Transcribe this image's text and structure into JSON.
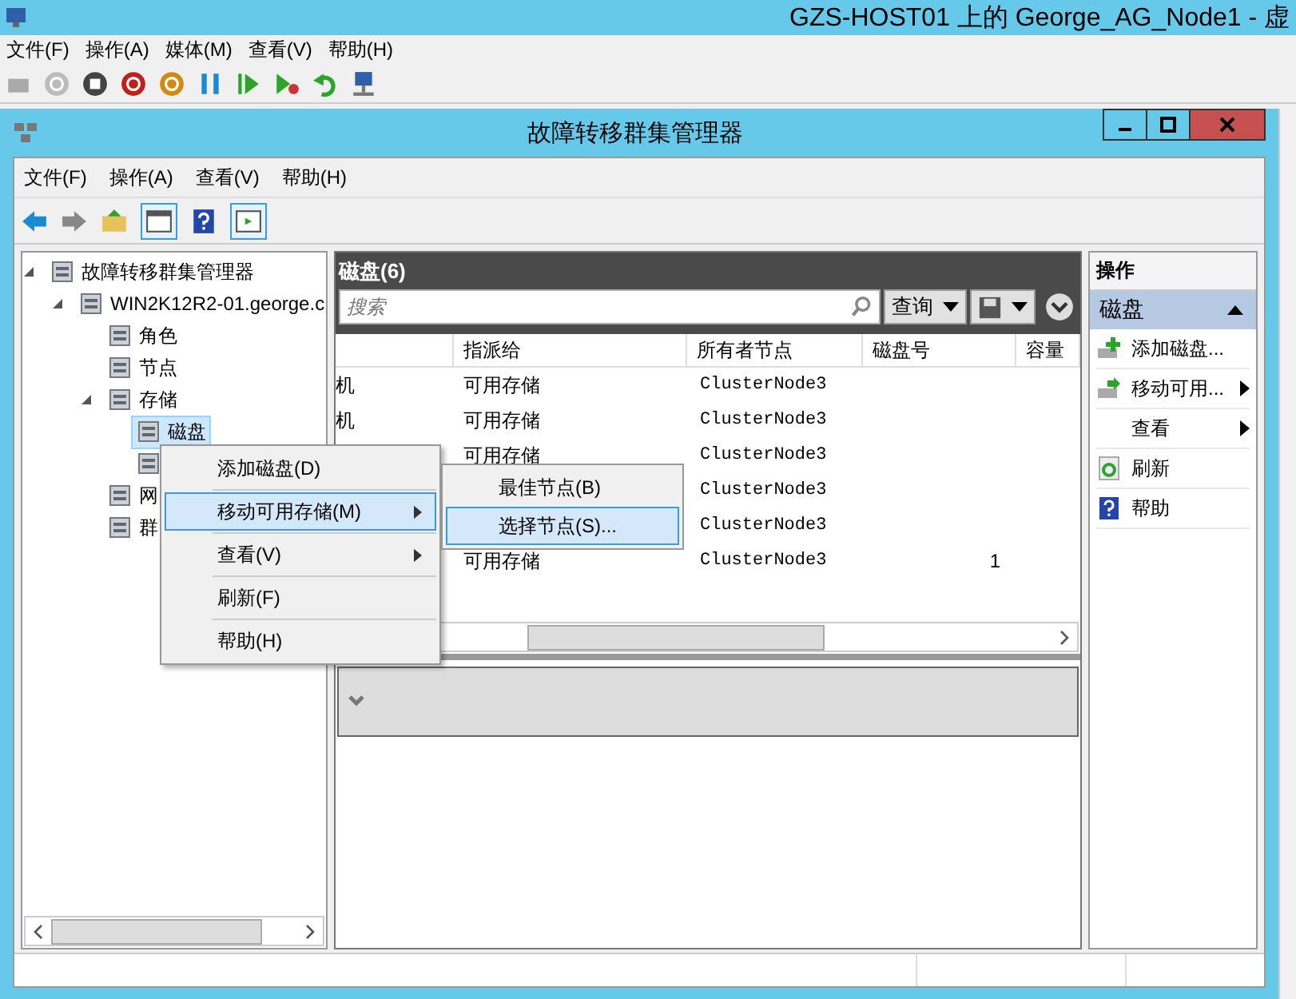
{
  "host_window": {
    "title": "GZS-HOST01 上的 George_AG_Node1 - 虚",
    "menu": [
      "文件(F)",
      "操作(A)",
      "媒体(M)",
      "查看(V)",
      "帮助(H)"
    ]
  },
  "window": {
    "title": "故障转移群集管理器",
    "menu": [
      "文件(F)",
      "操作(A)",
      "查看(V)",
      "帮助(H)"
    ]
  },
  "tree": [
    {
      "label": "故障转移群集管理器",
      "selected": false,
      "expanded": true,
      "children": [
        {
          "label": "WIN2K12R2-01.george.c",
          "selected": false,
          "expanded": true,
          "children": [
            {
              "label": "角色",
              "selected": false
            },
            {
              "label": "节点",
              "selected": false
            },
            {
              "label": "存储",
              "selected": false,
              "expanded": true,
              "children": [
                {
                  "label": "磁盘",
                  "selected": true
                },
                {
                  "selected": false
                }
              ]
            },
            {
              "label": "网",
              "selected": false
            },
            {
              "label": "群",
              "selected": false
            }
          ]
        }
      ]
    }
  ],
  "center": {
    "title": "磁盘(6)",
    "search": {
      "placeholder": "搜索"
    },
    "query_button": "查询",
    "columns": [
      "",
      "指派给",
      "所有者节点",
      "磁盘号",
      "容量"
    ],
    "rows": [
      {
        "column_1": "机",
        "assigned": "可用存储",
        "owner": "ClusterNode3",
        "disk": ""
      },
      {
        "column_1": "机",
        "assigned": "可用存储",
        "owner": "ClusterNode3",
        "disk": ""
      },
      {
        "column_1": "",
        "assigned": "可用存储",
        "owner": "ClusterNode3",
        "disk": ""
      },
      {
        "column_1": "",
        "assigned": "",
        "owner": "ClusterNode3",
        "disk": ""
      },
      {
        "column_1": "",
        "assigned": "",
        "owner": "ClusterNode3",
        "disk": ""
      },
      {
        "column_1": "",
        "assigned": "可用存储",
        "owner": "ClusterNode3",
        "disk": "1"
      }
    ]
  },
  "context_menu": [
    {
      "label": "添加磁盘(D)",
      "selected": false,
      "submenu": false
    },
    {
      "label": "移动可用存储(M)",
      "selected": true,
      "submenu": true
    },
    {
      "label": "查看(V)",
      "selected": false,
      "submenu": true
    },
    {
      "label": "刷新(F)",
      "selected": false,
      "submenu": false
    },
    {
      "label": "帮助(H)",
      "selected": false,
      "submenu": false
    }
  ],
  "submenu": [
    {
      "label": "最佳节点(B)",
      "selected": false
    },
    {
      "label": "选择节点(S)...",
      "selected": true
    }
  ],
  "actions": {
    "title": "操作",
    "section": "磁盘",
    "items": [
      {
        "kind": "add",
        "label": "添加磁盘...",
        "submenu": false
      },
      {
        "kind": "move",
        "label": "移动可用...",
        "submenu": true
      },
      {
        "kind": "plain",
        "label": "查看",
        "submenu": true
      },
      {
        "kind": "refresh",
        "label": "刷新",
        "submenu": false
      },
      {
        "kind": "help",
        "label": "帮助",
        "submenu": false
      }
    ]
  }
}
